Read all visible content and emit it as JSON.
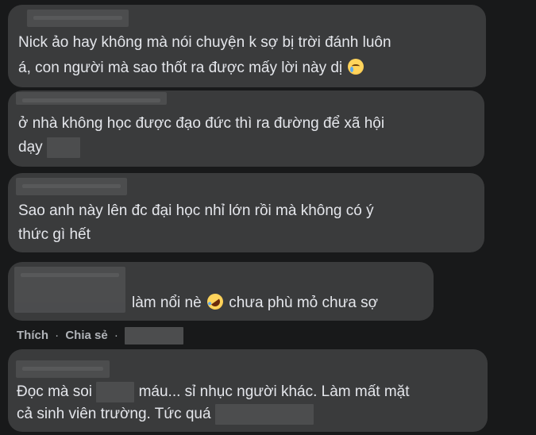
{
  "comments": [
    {
      "line1": "Nick ảo hay không mà nói chuyện k sợ bị trời đánh luôn",
      "line2": "á, con người mà sao thốt ra được mấy lời này dị",
      "emoji": "crying-face-icon"
    },
    {
      "line1": "ở nhà không học được đạo đức thì ra đường để xã hội",
      "line2": "dạy"
    },
    {
      "line1": "Sao anh này lên đc đại học nhỉ lớn rồi mà không có ý",
      "line2": "thức gì hết"
    },
    {
      "line1_a": "làm nổi nè",
      "line1_b": "chưa phù mỏ chưa sợ",
      "emoji": "rofl-face-icon"
    },
    {
      "line1_a": "Đọc mà soi",
      "line1_b": "máu... sỉ nhục người khác. Làm mất mặt",
      "line2": "cả sinh viên trường. Tức quá"
    }
  ],
  "actions": {
    "like": "Thích",
    "separator": "·",
    "share": "Chia sẻ",
    "separator2": "·"
  },
  "colors": {
    "background": "#18191a",
    "bubble": "#3a3b3c",
    "text": "#e4e6eb",
    "action_text": "#b0b3b8"
  }
}
